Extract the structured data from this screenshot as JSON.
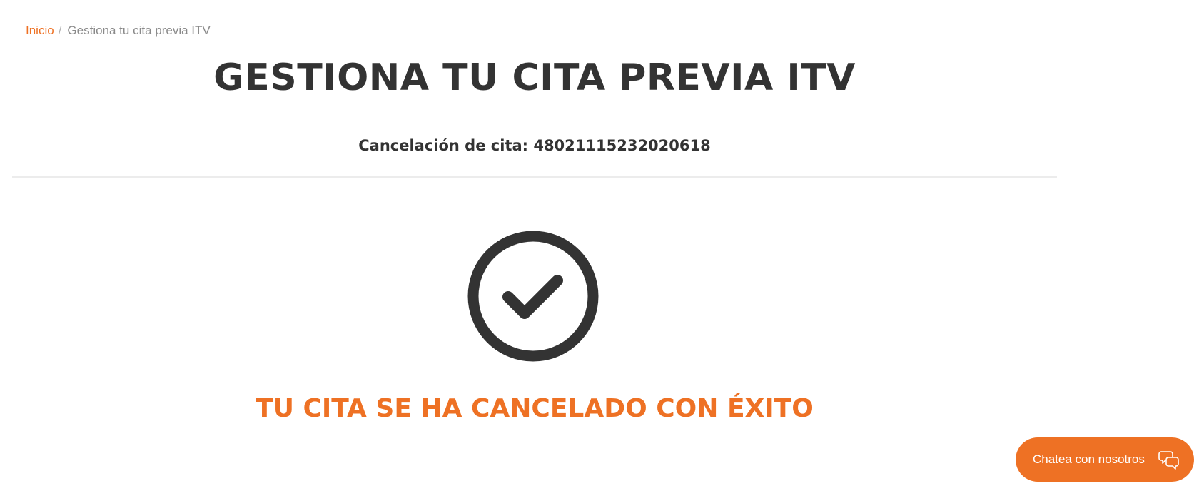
{
  "breadcrumb": {
    "home": "Inicio",
    "separator": "/",
    "current": "Gestiona tu cita previa ITV"
  },
  "page": {
    "title": "GESTIONA TU CITA PREVIA ITV",
    "cancellation_line": "Cancelación de cita: 48021115232020618"
  },
  "result": {
    "icon": "check-circle-icon",
    "message": "TU CITA SE HA CANCELADO CON ÉXITO"
  },
  "chat": {
    "label": "Chatea con nosotros",
    "icon": "chat-bubbles-icon"
  },
  "colors": {
    "accent": "#ee7124",
    "text": "#333333",
    "muted": "#8a8a8a",
    "divider": "#ececec"
  }
}
